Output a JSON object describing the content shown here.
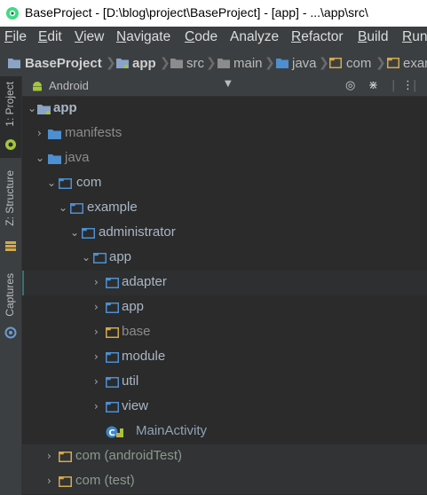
{
  "window": {
    "title": "BaseProject - [D:\\blog\\project\\BaseProject] - [app] - ...\\app\\src\\"
  },
  "menu": [
    {
      "label": "File",
      "mnemonic": "F",
      "rest": "ile"
    },
    {
      "label": "Edit",
      "mnemonic": "E",
      "rest": "dit"
    },
    {
      "label": "View",
      "mnemonic": "V",
      "rest": "iew"
    },
    {
      "label": "Navigate",
      "mnemonic": "N",
      "rest": "avigate"
    },
    {
      "label": "Code",
      "mnemonic": "C",
      "rest": "ode"
    },
    {
      "label": "Analyze",
      "mnemonic": "",
      "rest": "Analyze"
    },
    {
      "label": "Refactor",
      "mnemonic": "R",
      "rest": "efactor"
    },
    {
      "label": "Build",
      "mnemonic": "B",
      "rest": "uild"
    },
    {
      "label": "Run",
      "mnemonic": "R",
      "rest": "un"
    }
  ],
  "breadcrumbs": [
    "BaseProject",
    "app",
    "src",
    "main",
    "java",
    "com",
    "exam"
  ],
  "side_tabs": {
    "project": "1: Project",
    "structure": "Z: Structure",
    "captures": "Captures"
  },
  "panel": {
    "view_mode": "Android",
    "dropdown_icon": "triangle-down-icon",
    "actions": [
      "target-icon",
      "collapse-all-icon",
      "gear-icon"
    ]
  },
  "tree": [
    {
      "label": "app",
      "expanded": true,
      "icon": "module-folder-icon"
    },
    {
      "label": "manifests",
      "expanded": false,
      "icon": "folder-icon"
    },
    {
      "label": "java",
      "expanded": true,
      "icon": "folder-icon"
    },
    {
      "label": "com",
      "expanded": true,
      "icon": "package-icon"
    },
    {
      "label": "example",
      "expanded": true,
      "icon": "package-icon"
    },
    {
      "label": "administrator",
      "expanded": true,
      "icon": "package-icon"
    },
    {
      "label": "app",
      "expanded": true,
      "icon": "package-icon"
    },
    {
      "label": "adapter",
      "expanded": false,
      "icon": "package-icon",
      "selected": true
    },
    {
      "label": "app",
      "expanded": false,
      "icon": "package-icon"
    },
    {
      "label": "base",
      "expanded": false,
      "icon": "package-icon"
    },
    {
      "label": "module",
      "expanded": false,
      "icon": "package-icon"
    },
    {
      "label": "util",
      "expanded": false,
      "icon": "package-icon"
    },
    {
      "label": "view",
      "expanded": false,
      "icon": "package-icon"
    },
    {
      "label": "MainActivity",
      "icon": "class-icon"
    },
    {
      "label": "com (androidTest)",
      "expanded": false,
      "icon": "package-icon"
    },
    {
      "label": "com (test)",
      "expanded": false,
      "icon": "package-icon"
    }
  ],
  "colors": {
    "background": "#2b2b2b",
    "panel": "#3c3f41",
    "folder_blue": "#4d8fd1",
    "folder_yellow": "#d4a94a",
    "text": "#a9b7c6",
    "android_green": "#a4c639"
  }
}
